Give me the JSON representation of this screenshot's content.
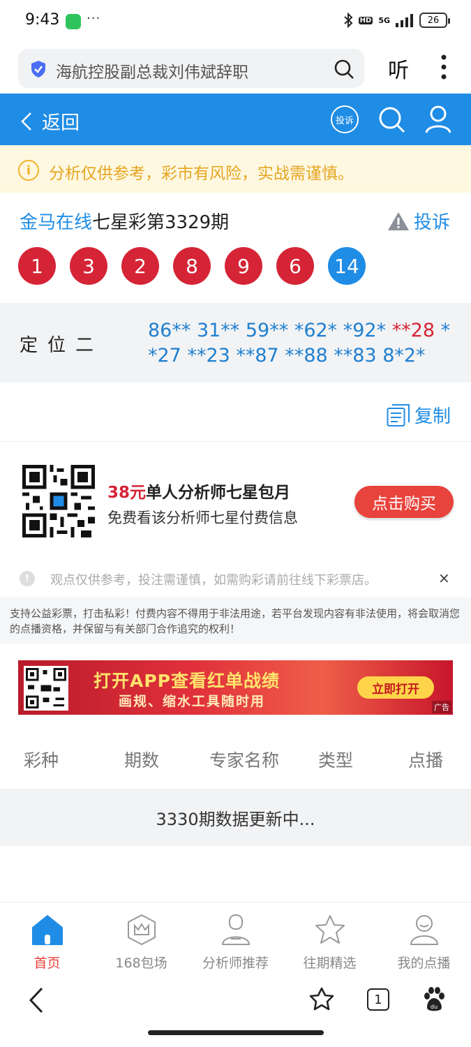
{
  "status_bar": {
    "time": "9:43",
    "dots": "···",
    "network": "5G",
    "battery": "26"
  },
  "browser": {
    "search_text": "海航控股副总裁刘伟斌辞职",
    "listen_label": "听"
  },
  "nav": {
    "back_label": "返回",
    "complain_label": "投诉"
  },
  "notice": {
    "text": "分析仅供参考，彩市有风险，实战需谨慎。"
  },
  "header": {
    "site": "金马在线",
    "issue": "七星彩第3329期",
    "report_label": "投诉"
  },
  "balls": [
    "1",
    "3",
    "2",
    "8",
    "9",
    "6",
    "14"
  ],
  "position": {
    "label": "定位二",
    "numbers_before": "86** 31** 59** *62* *92* ",
    "numbers_highlight": "**28",
    "numbers_after": " **27 **23 **87 **88 **83 8*2*"
  },
  "copy_label": "复制",
  "promo": {
    "price": "38元",
    "title": "单人分析师七星包月",
    "subtitle": "免费看该分析师七星付费信息",
    "button": "点击购买"
  },
  "tip": {
    "text": "观点仅供参考，投注需谨慎，如需购彩请前往线下彩票店。",
    "close": "×"
  },
  "disclaimer": "支持公益彩票，打击私彩！付费内容不得用于非法用途，若平台发现内容有非法使用，将会取消您的点播资格，并保留与有关部门合作追究的权利！",
  "ad": {
    "headline": "打开APP查看红单战绩",
    "subline": "画规、缩水工具随时用",
    "button": "立即打开",
    "tag": "广告"
  },
  "table": {
    "headers": [
      "彩种",
      "期数",
      "专家名称",
      "类型",
      "点播"
    ],
    "status": "3330期数据更新中..."
  },
  "tabs": [
    {
      "label": "首页",
      "icon": "home-icon",
      "active": true
    },
    {
      "label": "168包场",
      "icon": "crown-icon",
      "active": false
    },
    {
      "label": "分析师推荐",
      "icon": "analyst-icon",
      "active": false
    },
    {
      "label": "往期精选",
      "icon": "star-icon",
      "active": false
    },
    {
      "label": "我的点播",
      "icon": "profile-icon",
      "active": false
    }
  ],
  "browser_bottom": {
    "tab_count": "1"
  },
  "colors": {
    "brand_blue": "#1f8ce5",
    "red": "#d52436",
    "notice_bg": "#fff8e0"
  }
}
